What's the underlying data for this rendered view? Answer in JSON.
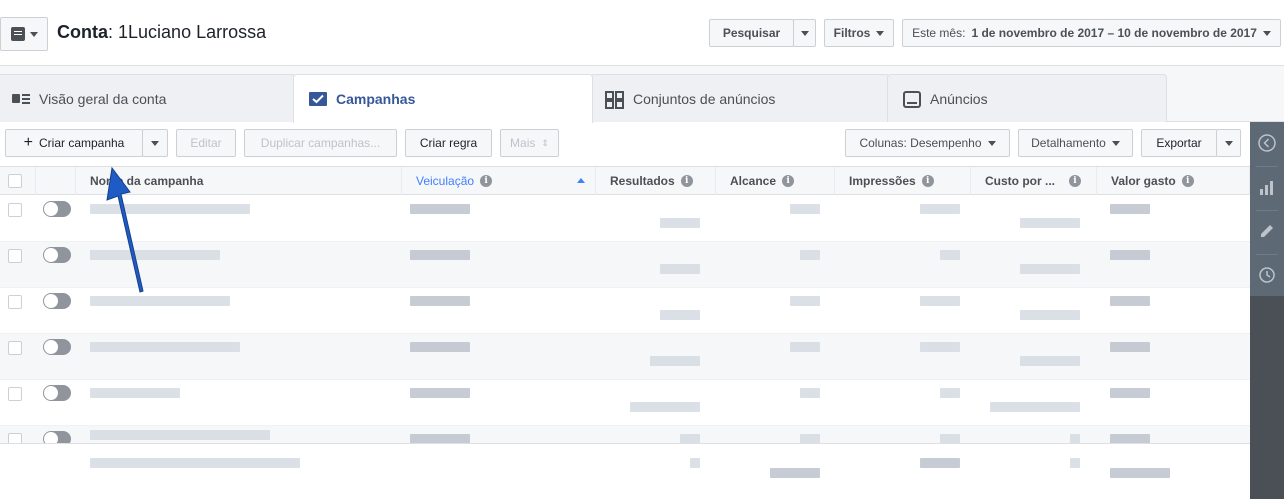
{
  "header": {
    "account_label": "Conta",
    "account_name": "1Luciano Larrossa",
    "search_button": "Pesquisar",
    "filters_button": "Filtros",
    "date_range_prefix": "Este mês:",
    "date_range_value": "1 de novembro de 2017 – 10 de novembro de 2017"
  },
  "tabs": [
    {
      "label": "Visão geral da conta",
      "icon": "account-overview-icon",
      "active": false
    },
    {
      "label": "Campanhas",
      "icon": "campaigns-checkbox-icon",
      "active": true
    },
    {
      "label": "Conjuntos de anúncios",
      "icon": "adsets-grid-icon",
      "active": false
    },
    {
      "label": "Anúncios",
      "icon": "ads-monitor-icon",
      "active": false
    }
  ],
  "toolbar": {
    "create_label": "Criar campanha",
    "edit_label": "Editar",
    "duplicate_label": "Duplicar campanhas...",
    "create_rule_label": "Criar regra",
    "more_label": "Mais",
    "columns_label": "Colunas: Desempenho",
    "breakdown_label": "Detalhamento",
    "export_label": "Exportar"
  },
  "table": {
    "columns": [
      {
        "label": "Nome da campanha",
        "info": false
      },
      {
        "label": "Veiculação",
        "info": true,
        "sorted": "asc"
      },
      {
        "label": "Resultados",
        "info": true
      },
      {
        "label": "Alcance",
        "info": true
      },
      {
        "label": "Impressões",
        "info": true
      },
      {
        "label": "Custo por ...",
        "info": true
      },
      {
        "label": "Valor gasto",
        "info": true
      }
    ],
    "row_count": 6
  },
  "colors": {
    "accent": "#4080ff",
    "active_tab": "#365899",
    "rail": "#4b4f56",
    "annotation_arrow": "#1f5bc4"
  },
  "rail": {
    "items": [
      "collapse-chevron-icon",
      "bar-chart-icon",
      "pencil-icon",
      "clock-icon"
    ]
  }
}
